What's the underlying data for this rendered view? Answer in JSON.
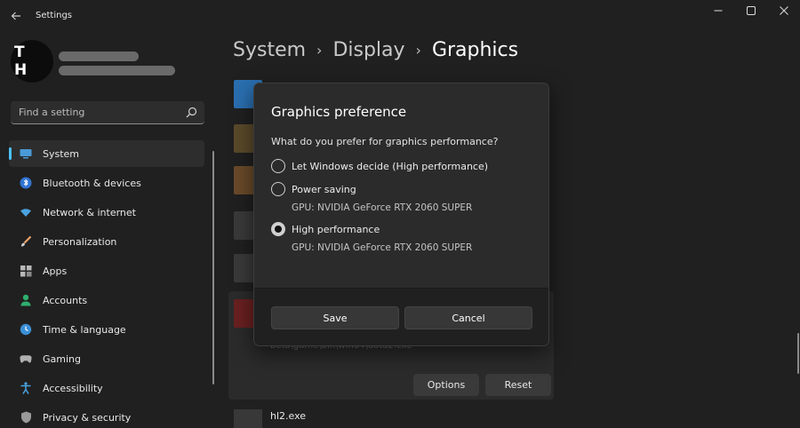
{
  "window": {
    "title": "Settings"
  },
  "user": {
    "initials": "T H"
  },
  "search": {
    "placeholder": "Find a setting"
  },
  "sidebar": {
    "items": [
      {
        "label": "System",
        "icon": "monitor-icon",
        "active": true
      },
      {
        "label": "Bluetooth & devices",
        "icon": "bluetooth-icon"
      },
      {
        "label": "Network & internet",
        "icon": "wifi-icon"
      },
      {
        "label": "Personalization",
        "icon": "brush-icon"
      },
      {
        "label": "Apps",
        "icon": "apps-grid-icon"
      },
      {
        "label": "Accounts",
        "icon": "person-icon"
      },
      {
        "label": "Time & language",
        "icon": "globe-clock-icon"
      },
      {
        "label": "Gaming",
        "icon": "gamepad-icon"
      },
      {
        "label": "Accessibility",
        "icon": "accessibility-icon"
      },
      {
        "label": "Privacy & security",
        "icon": "shield-icon"
      }
    ]
  },
  "breadcrumb": {
    "items": [
      "System",
      "Display",
      "Graphics"
    ]
  },
  "app_list": {
    "card": {
      "path": "beta\\game\\bin\\win64\\dota2.exe",
      "options_label": "Options",
      "reset_label": "Reset"
    },
    "next_row": {
      "name": "hl2.exe"
    }
  },
  "dialog": {
    "title": "Graphics preference",
    "question": "What do you prefer for graphics performance?",
    "options": [
      {
        "label": "Let Windows decide (High performance)",
        "gpu": ""
      },
      {
        "label": "Power saving",
        "gpu": "GPU: NVIDIA GeForce RTX 2060 SUPER"
      },
      {
        "label": "High performance",
        "gpu": "GPU: NVIDIA GeForce RTX 2060 SUPER"
      }
    ],
    "selected_index": 2,
    "save_label": "Save",
    "cancel_label": "Cancel"
  },
  "colors": {
    "accent": "#4cc2ff",
    "background": "#202020",
    "dialog_bg": "#2b2b2b"
  }
}
